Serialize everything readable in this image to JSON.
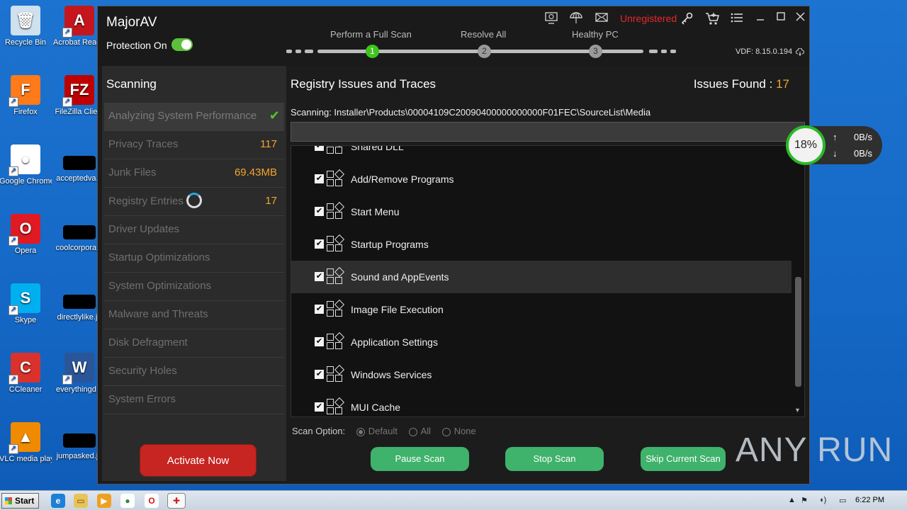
{
  "desktop": {
    "icons": [
      {
        "label": "Recycle Bin",
        "icon": "recycle-bin-icon",
        "glyph": "🗑",
        "color": "#cfe0ef"
      },
      {
        "label": "Acrobat Reader DC",
        "icon": "acrobat-icon",
        "glyph": "A",
        "color": "#c4161c"
      },
      {
        "label": "Firefox",
        "icon": "firefox-icon",
        "glyph": "F",
        "color": "#ff7a18"
      },
      {
        "label": "FileZilla Client",
        "icon": "filezilla-icon",
        "glyph": "FZ",
        "color": "#bf0000"
      },
      {
        "label": "Google Chrome",
        "icon": "chrome-icon",
        "glyph": "●",
        "color": "#ffffff"
      },
      {
        "label": "acceptedva...",
        "icon": "file-icon",
        "glyph": "",
        "color": "#000000"
      },
      {
        "label": "Opera",
        "icon": "opera-icon",
        "glyph": "O",
        "color": "#e01a23"
      },
      {
        "label": "coolcorpora...",
        "icon": "file-icon",
        "glyph": "",
        "color": "#000000"
      },
      {
        "label": "Skype",
        "icon": "skype-icon",
        "glyph": "S",
        "color": "#00aff0"
      },
      {
        "label": "directlylike.jp",
        "icon": "file-icon",
        "glyph": "",
        "color": "#000000"
      },
      {
        "label": "CCleaner",
        "icon": "ccleaner-icon",
        "glyph": "C",
        "color": "#d9322d"
      },
      {
        "label": "everythingd...",
        "icon": "word-doc-icon",
        "glyph": "W",
        "color": "#2a5699"
      },
      {
        "label": "VLC media player",
        "icon": "vlc-icon",
        "glyph": "▲",
        "color": "#f08a00"
      },
      {
        "label": "jumpasked.jp",
        "icon": "file-icon",
        "glyph": "",
        "color": "#000000"
      }
    ]
  },
  "app": {
    "name": "MajorAV",
    "protection_label": "Protection On",
    "protection_on": true,
    "unregistered": "Unregistered",
    "vdf": "VDF: 8.15.0.194",
    "steps": [
      {
        "label": "Perform a Full Scan",
        "num": "1",
        "active": true
      },
      {
        "label": "Resolve All",
        "num": "2",
        "active": false
      },
      {
        "label": "Healthy PC",
        "num": "3",
        "active": false
      }
    ]
  },
  "sidebar": {
    "title": "Scanning",
    "items": [
      {
        "label": "Analyzing System Performance",
        "value": "",
        "status": "done"
      },
      {
        "label": "Privacy Traces",
        "value": "117",
        "status": ""
      },
      {
        "label": "Junk Files",
        "value": "69.43MB",
        "status": ""
      },
      {
        "label": "Registry Entries",
        "value": "17",
        "status": "scanning"
      },
      {
        "label": "Driver Updates",
        "value": "",
        "status": ""
      },
      {
        "label": "Startup Optimizations",
        "value": "",
        "status": ""
      },
      {
        "label": "System Optimizations",
        "value": "",
        "status": ""
      },
      {
        "label": "Malware and Threats",
        "value": "",
        "status": ""
      },
      {
        "label": "Disk Defragment",
        "value": "",
        "status": ""
      },
      {
        "label": "Security Holes",
        "value": "",
        "status": ""
      },
      {
        "label": "System Errors",
        "value": "",
        "status": ""
      }
    ],
    "activate_label": "Activate Now"
  },
  "main": {
    "title": "Registry Issues and Traces",
    "issues_label": "Issues Found :",
    "issues_count": "17",
    "scanning_path": "Scanning: Installer\\Products\\00004109C20090400000000000F01FEC\\SourceList\\Media",
    "list": [
      {
        "label": "Shared DLL",
        "checked": true
      },
      {
        "label": "Add/Remove Programs",
        "checked": true
      },
      {
        "label": "Start Menu",
        "checked": true
      },
      {
        "label": "Startup Programs",
        "checked": true
      },
      {
        "label": "Sound and AppEvents",
        "checked": true,
        "selected": true
      },
      {
        "label": "Image File Execution",
        "checked": true
      },
      {
        "label": "Application Settings",
        "checked": true
      },
      {
        "label": "Windows Services",
        "checked": true
      },
      {
        "label": "MUI Cache",
        "checked": true
      }
    ],
    "scan_option_label": "Scan Option:",
    "scan_options": [
      "Default",
      "All",
      "None"
    ],
    "scan_option_selected": "Default",
    "buttons": {
      "pause": "Pause Scan",
      "stop": "Stop Scan",
      "skip": "Skip Current Scan"
    }
  },
  "gauge": {
    "percent": "18%",
    "up": "0B/s",
    "down": "0B/s",
    "up_arrow": "↑",
    "down_arrow": "↓"
  },
  "watermark": "ANY RUN",
  "taskbar": {
    "start": "Start",
    "clock": "6:22 PM"
  }
}
